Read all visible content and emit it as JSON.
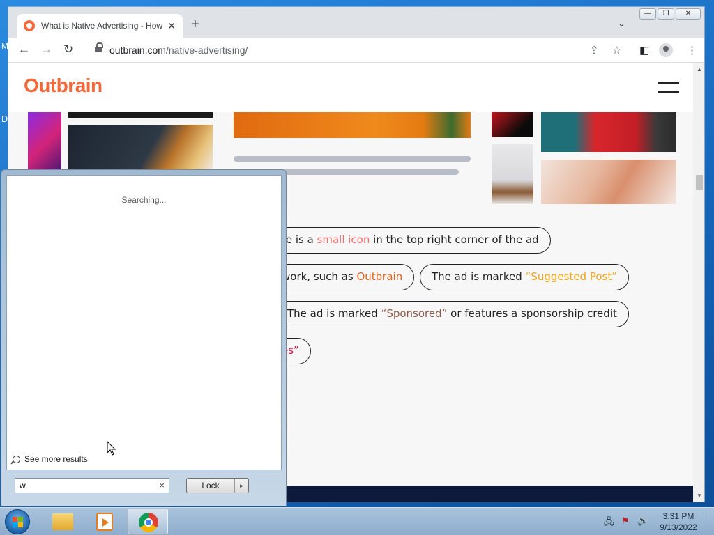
{
  "desktop": {
    "frag1": "M",
    "frag2": "D"
  },
  "browser": {
    "tab_title": "What is Native Advertising - How",
    "tab_close": "✕",
    "new_tab": "+",
    "tab_search": "⌄",
    "url_host": "outbrain.com",
    "url_path": "/native-advertising/",
    "win_min": "—",
    "win_max": "❐",
    "win_close": "✕",
    "back": "←",
    "forward": "→",
    "reload": "↻",
    "share": "⇪",
    "star": "☆",
    "side_panel": "◧",
    "menu": "⋮"
  },
  "page": {
    "logo": "Outbrain",
    "pills": {
      "p1": {
        "pre": "re is a ",
        "hl": "small icon",
        "post": " in the top right corner of the ad"
      },
      "p2": {
        "pre": "work, such as ",
        "hl": "Outbrain",
        "post": ""
      },
      "p3": {
        "pre": "The ad is marked ",
        "hl": "“Suggested Post”",
        "post": ""
      },
      "p4": {
        "pre": "The ad is marked ",
        "hl": "“Sponsored”",
        "post": " or features a sponsorship credit"
      },
      "p5": {
        "pre": "",
        "hl": "es”",
        "post": ""
      }
    }
  },
  "startmenu": {
    "status": "Searching...",
    "see_more": "See more results",
    "search_value": "w",
    "clear": "×",
    "lock_label": "Lock",
    "lock_arrow": "▸"
  },
  "taskbar": {
    "clock_time": "3:31 PM",
    "clock_date": "9/13/2022",
    "tray_network": "🖧",
    "tray_flag": "⚑",
    "tray_volume": "🔊"
  },
  "colors": {
    "brand": "#f4683a",
    "taskbar": "#8eadcc"
  }
}
